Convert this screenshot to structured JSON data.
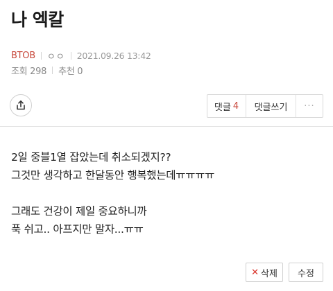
{
  "post": {
    "title": "나 엑칼",
    "author": "BTOB",
    "tag_icon": "ㅇㅇ",
    "date": "2021.09.26 13:42",
    "views_label": "조회 298",
    "recommend_label": "추천 0"
  },
  "toolbar": {
    "share_icon": "share-icon",
    "comments_label": "댓글",
    "comments_count": "4",
    "write_comment_label": "댓글쓰기",
    "more_label": "···"
  },
  "content": {
    "lines": [
      "2일 중블1열 잡았는데 취소되겠지??",
      "그것만 생각하고 한달동안 행복했는데ㅠㅠㅠㅠ",
      "",
      "그래도 건강이 제일 중요하니까",
      "푹 쉬고.. 아프지만 말자...ㅠㅠ"
    ]
  },
  "actions": {
    "delete_icon": "✕",
    "delete_label": "삭제",
    "edit_label": "수정"
  },
  "colors": {
    "accent": "#c8493c",
    "delete_x": "#d9342b"
  }
}
